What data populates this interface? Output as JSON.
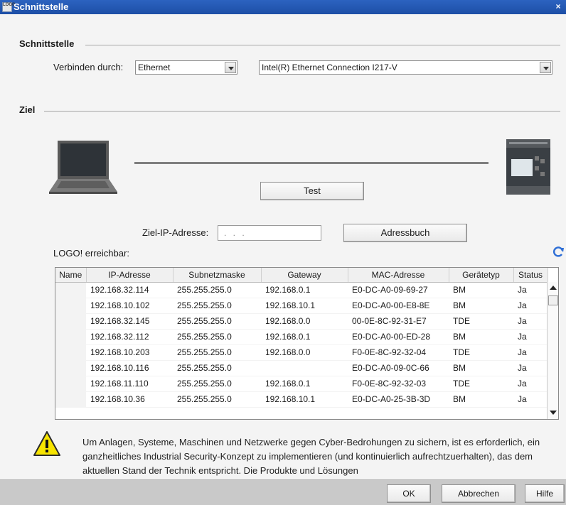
{
  "window": {
    "title": "Schnittstelle",
    "icon_text": "LOGO",
    "close_label": "×"
  },
  "interface": {
    "section_label": "Schnittstelle",
    "connect_label": "Verbinden durch:",
    "connect_value": "Ethernet",
    "adapter_value": "Intel(R) Ethernet Connection I217-V"
  },
  "target": {
    "section_label": "Ziel",
    "test_button": "Test",
    "ip_label": "Ziel-IP-Adresse:",
    "ip_placeholder": ". . .",
    "addressbook_button": "Adressbuch",
    "reachable_label": "LOGO! erreichbar:"
  },
  "table": {
    "columns": [
      "Name",
      "IP-Adresse",
      "Subnetzmaske",
      "Gateway",
      "MAC-Adresse",
      "Gerätetyp",
      "Status"
    ],
    "rows": [
      [
        "",
        "192.168.32.114",
        "255.255.255.0",
        "192.168.0.1",
        "E0-DC-A0-09-69-27",
        "BM",
        "Ja"
      ],
      [
        "",
        "192.168.10.102",
        "255.255.255.0",
        "192.168.10.1",
        "E0-DC-A0-00-E8-8E",
        "BM",
        "Ja"
      ],
      [
        "",
        "192.168.32.145",
        "255.255.255.0",
        "192.168.0.0",
        "00-0E-8C-92-31-E7",
        "TDE",
        "Ja"
      ],
      [
        "",
        "192.168.32.112",
        "255.255.255.0",
        "192.168.0.1",
        "E0-DC-A0-00-ED-28",
        "BM",
        "Ja"
      ],
      [
        "",
        "192.168.10.203",
        "255.255.255.0",
        "192.168.0.0",
        "F0-0E-8C-92-32-04",
        "TDE",
        "Ja"
      ],
      [
        "",
        "192.168.10.116",
        "255.255.255.0",
        "",
        "E0-DC-A0-09-0C-66",
        "BM",
        "Ja"
      ],
      [
        "",
        "192.168.11.110",
        "255.255.255.0",
        "192.168.0.1",
        "F0-0E-8C-92-32-03",
        "TDE",
        "Ja"
      ],
      [
        "",
        "192.168.10.36",
        "255.255.255.0",
        "192.168.10.1",
        "E0-DC-A0-25-3B-3D",
        "BM",
        "Ja"
      ]
    ]
  },
  "warning": {
    "text": "Um Anlagen, Systeme, Maschinen und Netzwerke gegen Cyber-Bedrohungen zu sichern, ist es erforderlich, ein ganzheitliches Industrial Security-Konzept zu implementieren (und kontinuierlich aufrechtzuerhalten), das dem aktuellen Stand der Technik entspricht. Die Produkte und Lösungen"
  },
  "footer": {
    "ok": "OK",
    "cancel": "Abbrechen",
    "help": "Hilfe"
  },
  "icons": {
    "refresh": "refresh-icon",
    "warning": "warning-icon",
    "laptop": "laptop-icon",
    "device": "logo-device-icon"
  },
  "colors": {
    "titlebar": "#1d4fa6",
    "refresh": "#2f6fd6",
    "warning_fill": "#f7e400"
  }
}
